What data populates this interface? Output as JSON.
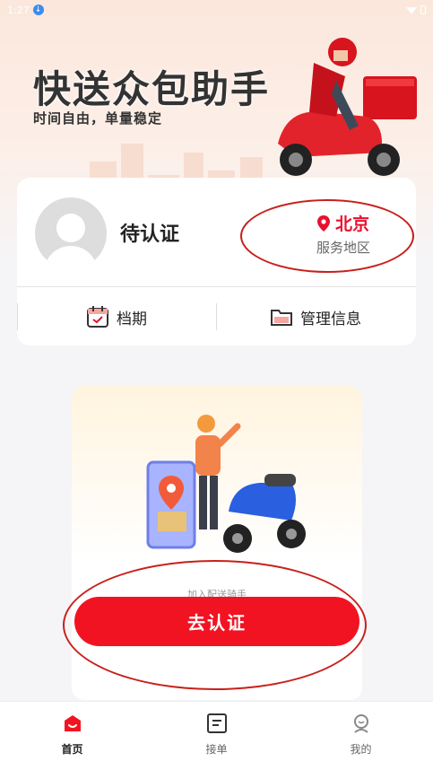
{
  "status_bar": {
    "time": "1:27"
  },
  "hero": {
    "title": "快送众包助手",
    "subtitle": "时间自由，单量稳定"
  },
  "profile": {
    "status": "待认证",
    "region_city": "北京",
    "region_label": "服务地区",
    "actions": [
      {
        "label": "档期",
        "icon": "calendar-check-icon"
      },
      {
        "label": "管理信息",
        "icon": "folder-icon"
      }
    ]
  },
  "certification": {
    "join_text": "加入配送骑手",
    "button_label": "去认证"
  },
  "tabbar": {
    "items": [
      {
        "label": "首页",
        "icon": "home-icon",
        "active": true
      },
      {
        "label": "接单",
        "icon": "order-icon",
        "active": false
      },
      {
        "label": "我的",
        "icon": "profile-icon",
        "active": false
      }
    ]
  },
  "colors": {
    "brand_red": "#f21322",
    "annotation_red": "#c8201b"
  }
}
